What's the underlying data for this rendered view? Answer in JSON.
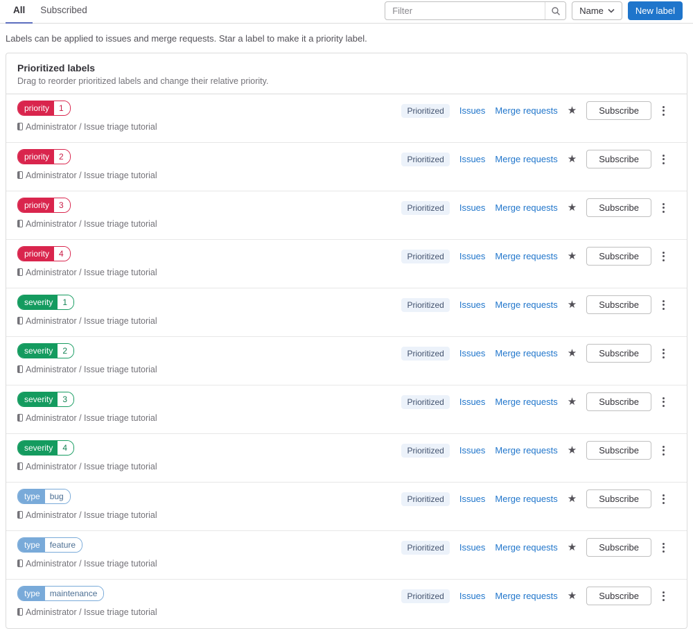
{
  "tabs": [
    {
      "label": "All",
      "active": true
    },
    {
      "label": "Subscribed",
      "active": false
    }
  ],
  "toolbar": {
    "filter_placeholder": "Filter",
    "sort_label": "Name",
    "new_label_button": "New label"
  },
  "description": "Labels can be applied to issues and merge requests. Star a label to make it a priority label.",
  "card": {
    "title": "Prioritized labels",
    "subtitle": "Drag to reorder prioritized labels and change their relative priority.",
    "project": "Administrator / Issue triage tutorial",
    "row_actions": {
      "prioritized": "Prioritized",
      "issues": "Issues",
      "merge_requests": "Merge requests",
      "subscribe": "Subscribe"
    },
    "labels": [
      {
        "scope": "priority",
        "value": "1",
        "color": "#d9254d",
        "text_color": "#c91c45"
      },
      {
        "scope": "priority",
        "value": "2",
        "color": "#d9254d",
        "text_color": "#c91c45"
      },
      {
        "scope": "priority",
        "value": "3",
        "color": "#d9254d",
        "text_color": "#c91c45"
      },
      {
        "scope": "priority",
        "value": "4",
        "color": "#d9254d",
        "text_color": "#c91c45"
      },
      {
        "scope": "severity",
        "value": "1",
        "color": "#149b5f",
        "text_color": "#118252"
      },
      {
        "scope": "severity",
        "value": "2",
        "color": "#149b5f",
        "text_color": "#118252"
      },
      {
        "scope": "severity",
        "value": "3",
        "color": "#149b5f",
        "text_color": "#118252"
      },
      {
        "scope": "severity",
        "value": "4",
        "color": "#149b5f",
        "text_color": "#118252"
      },
      {
        "scope": "type",
        "value": "bug",
        "color": "#79aad9",
        "text_color": "#4c6f93"
      },
      {
        "scope": "type",
        "value": "feature",
        "color": "#79aad9",
        "text_color": "#4c6f93"
      },
      {
        "scope": "type",
        "value": "maintenance",
        "color": "#79aad9",
        "text_color": "#4c6f93"
      }
    ]
  },
  "icons": {
    "search": "magnifier",
    "sort_chevron": "chevron-down",
    "star": "★",
    "kebab": "vertical-ellipsis",
    "project": "half-filled-square"
  },
  "colors": {
    "accent_blue": "#1f75cb",
    "tab_underline": "#5b6dbe",
    "prioritized_badge_bg": "#ecf2fa",
    "prioritized_badge_text": "#42526e",
    "border": "#dbdbdb"
  }
}
